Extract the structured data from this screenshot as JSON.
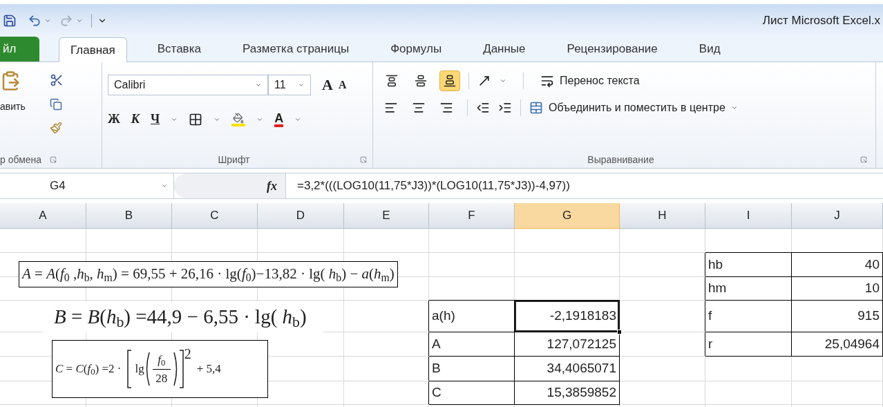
{
  "window": {
    "title": "Лист Microsoft Excel.x"
  },
  "tabs": [
    {
      "label": "йл",
      "kind": "file",
      "selected": false
    },
    {
      "label": "Главная",
      "kind": "tab",
      "selected": true
    },
    {
      "label": "Вставка",
      "kind": "tab",
      "selected": false
    },
    {
      "label": "Разметка страницы",
      "kind": "tab",
      "selected": false
    },
    {
      "label": "Формулы",
      "kind": "tab",
      "selected": false
    },
    {
      "label": "Данные",
      "kind": "tab",
      "selected": false
    },
    {
      "label": "Рецензирование",
      "kind": "tab",
      "selected": false
    },
    {
      "label": "Вид",
      "kind": "tab",
      "selected": false
    }
  ],
  "ribbon": {
    "clipboard": {
      "paste_label": "авить",
      "group_label": "р обмена"
    },
    "font": {
      "font_name": "Calibri",
      "font_size": "11",
      "grow": "A",
      "shrink": "A",
      "bold": "Ж",
      "italic": "К",
      "underline": "Ч",
      "color_letter": "A",
      "group_label": "Шрифт"
    },
    "alignment": {
      "vertical": [
        {
          "selected": false
        },
        {
          "selected": false
        },
        {
          "selected": true
        }
      ],
      "wrap_text": "Перенос текста",
      "merge": "Объединить и поместить в центре",
      "group_label": "Выравнивание"
    }
  },
  "formula_bar": {
    "name_box": "G4",
    "fx": "fx",
    "formula": "=3,2*(((LOG10(11,75*J3))*(LOG10(11,75*J3))-4,97))"
  },
  "columns": [
    {
      "label": "A",
      "selected": false
    },
    {
      "label": "B",
      "selected": false
    },
    {
      "label": "C",
      "selected": false
    },
    {
      "label": "D",
      "selected": false
    },
    {
      "label": "E",
      "selected": false
    },
    {
      "label": "F",
      "selected": false
    },
    {
      "label": "G",
      "selected": true
    },
    {
      "label": "H",
      "selected": false
    },
    {
      "label": "I",
      "selected": false
    },
    {
      "label": "J",
      "selected": false
    }
  ],
  "formula_a": "*A* = *A*(*f*$_{0}$ ,*h*$_{b}$, *h*$_{m}$) = 69,55 + 26,16 · lg(*f*$_{0}$)−13,82 · lg( *h*$_{b}$) − *a*(*h*$_{m}$)",
  "formula_b": "*B* = *B*(*h*$_{b}$) =44,9 − 6,55 · lg( *h*$_{b}$)",
  "formula_c": {
    "lhs": "*C* = *C*(*f*$_{0}$) =2 ·",
    "log": "lg",
    "numerator": "*f*$_{0}$",
    "denominator": "28",
    "exponent": "2",
    "tail": "+ 5,4"
  },
  "results_table": {
    "rows": [
      {
        "label": "a(h)",
        "value": "-2,1918183",
        "selected": true
      },
      {
        "label": "A",
        "value": "127,072125",
        "selected": false
      },
      {
        "label": "B",
        "value": "34,4065071",
        "selected": false
      },
      {
        "label": "C",
        "value": "15,3859852",
        "selected": false
      }
    ]
  },
  "parameters_table": {
    "rows": [
      {
        "label": "hb",
        "value": "40"
      },
      {
        "label": "hm",
        "value": "10"
      },
      {
        "label": "f",
        "value": "915"
      },
      {
        "label": "r",
        "value": "25,04964"
      }
    ]
  }
}
